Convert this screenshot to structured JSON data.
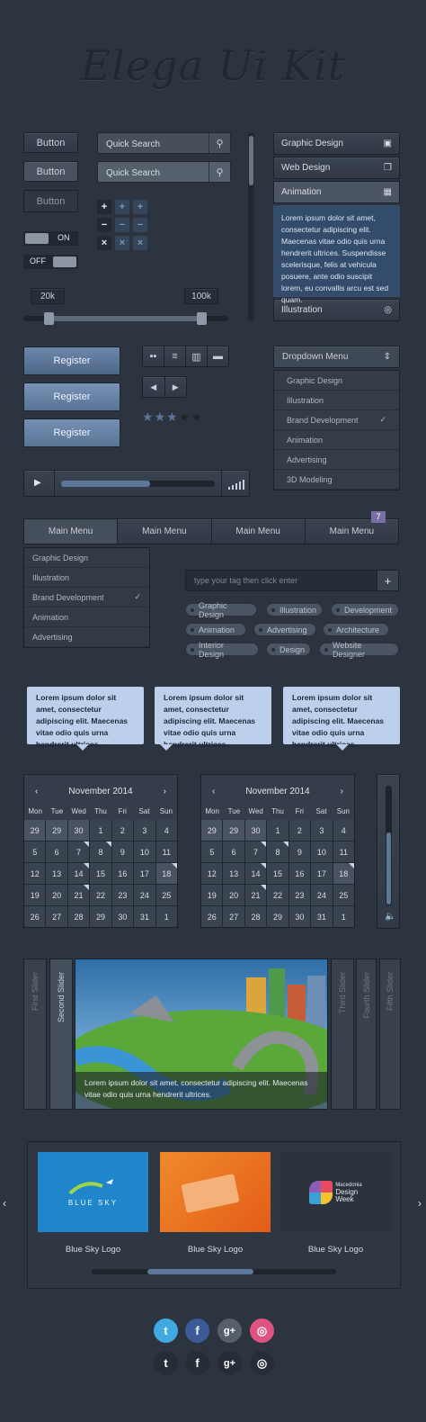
{
  "title": "Elega Ui Kit",
  "buttons": [
    "Button",
    "Button",
    "Button"
  ],
  "search": {
    "label1": "Quick Search",
    "label2": "Quick Search"
  },
  "toggles": {
    "on": "ON",
    "off": "OFF"
  },
  "range": {
    "min": "20k",
    "max": "100k"
  },
  "accordion": {
    "items": [
      "Graphic Design",
      "Web Design",
      "Animation",
      "Illustration"
    ],
    "body": "Lorem ipsum dolor sit amet, consectetur adipiscing elit. Maecenas vitae odio quis urna hendrerit ultrices. Suspendisse scelerisque, felis at vehicula posuere, ante odio suscipit lorem, eu convallis arcu est sed quam."
  },
  "register": [
    "Register",
    "Register",
    "Register"
  ],
  "rating": {
    "filled": 3,
    "total": 5
  },
  "dropdown": {
    "label": "Dropdown Menu",
    "items": [
      "Graphic Design",
      "Illustration",
      "Brand Development",
      "Animation",
      "Advertising",
      "3D Modeling"
    ],
    "selected": "Brand Development"
  },
  "player": {
    "progress": 0.58
  },
  "mainmenu": {
    "items": [
      "Main Menu",
      "Main Menu",
      "Main Menu",
      "Main Menu"
    ],
    "badge": "7",
    "sub": [
      "Graphic Design",
      "Illustration",
      "Brand Development",
      "Animation",
      "Advertising"
    ]
  },
  "tags": {
    "placeholder": "type your tag then click enter",
    "items": [
      "Graphic Design",
      "Illustration",
      "Development",
      "Animation",
      "Advertising",
      "Architecture",
      "Interior Design",
      "Design",
      "Website Designer"
    ]
  },
  "bubbles": [
    "Lorem ipsum dolor sit amet, consectetur adipiscing elit. Maecenas vitae odio quis urna hendrerit ultrices..",
    "Lorem ipsum dolor sit amet, consectetur adipiscing elit. Maecenas vitae odio quis urna hendrerit ultrices..",
    "Lorem ipsum dolor sit amet, consectetur adipiscing elit. Maecenas vitae odio quis urna hendrerit ultrices.."
  ],
  "calendar": {
    "month": "November 2014",
    "days": [
      "Mon",
      "Tue",
      "Wed",
      "Thu",
      "Fri",
      "Sat",
      "Sun"
    ],
    "cells": [
      "29",
      "29",
      "30",
      "1",
      "2",
      "3",
      "4",
      "5",
      "6",
      "7",
      "8",
      "9",
      "10",
      "11",
      "12",
      "13",
      "14",
      "15",
      "16",
      "17",
      "18",
      "19",
      "20",
      "21",
      "22",
      "23",
      "24",
      "25",
      "26",
      "27",
      "28",
      "29",
      "30",
      "31",
      "1"
    ]
  },
  "slider": {
    "tabs": [
      "First Slider",
      "Second Slider",
      "Third Slider",
      "Fourth Slider",
      "Fifth Slider"
    ],
    "caption": "Lorem ipsum dolor sit amet, consectetur adipiscing elit. Maecenas vitae odio quis urna hendrerit ultrices."
  },
  "carousel": {
    "items": [
      "Blue Sky Logo",
      "Blue Sky Logo",
      "Blue Sky Logo"
    ],
    "logo1": "BLUE SKY",
    "logo3a": "Macedonia",
    "logo3b": "Design",
    "logo3c": "Week"
  },
  "social": [
    "twitter",
    "facebook",
    "g+",
    "dribbble"
  ]
}
